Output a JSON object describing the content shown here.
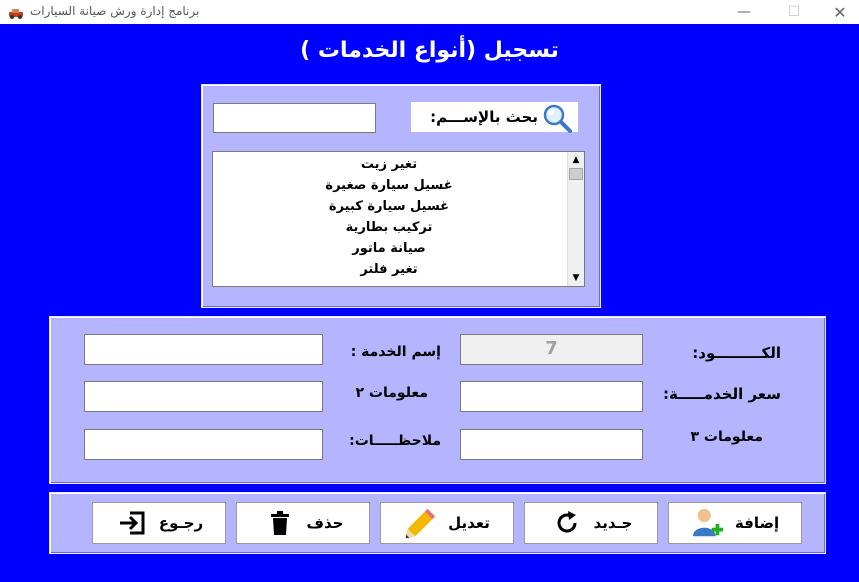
{
  "window": {
    "title": "برنامج إدارة ورش صيانة السيارات",
    "minimize_glyph": "—",
    "maximize_glyph": "☐",
    "close_glyph": "✕"
  },
  "form": {
    "title": "تسجيل (أنواع الخدمات )"
  },
  "search": {
    "label": "بحث بالإســـم:",
    "value": "",
    "icon": "magnifier-icon"
  },
  "services_list": {
    "items": [
      "تغير زيت",
      "غسيل سيارة صغيرة",
      "غسيل سيارة كبيرة",
      "تركيب بطارية",
      "صيانة ماتور",
      "تغير فلتر"
    ]
  },
  "fields": {
    "code_label": "الكـــــــــود:",
    "code_value": "7",
    "service_name_label": "إسم الخدمة :",
    "service_name_value": "",
    "service_price_label": "سعر الخدمـــــة:",
    "service_price_value": "",
    "info2_label": "معلومات ٢",
    "info2_value": "",
    "info3_label": "معلومات ٣",
    "info3_value": "",
    "notes_label": "ملاحظـــــات:",
    "notes_value": ""
  },
  "buttons": {
    "add": "إضافة",
    "new": "جـديد",
    "edit": "تعديل",
    "delete": "حذف",
    "back": "رجـوع"
  },
  "colors": {
    "background": "#0000ff",
    "panel": "#b4b4ff"
  }
}
